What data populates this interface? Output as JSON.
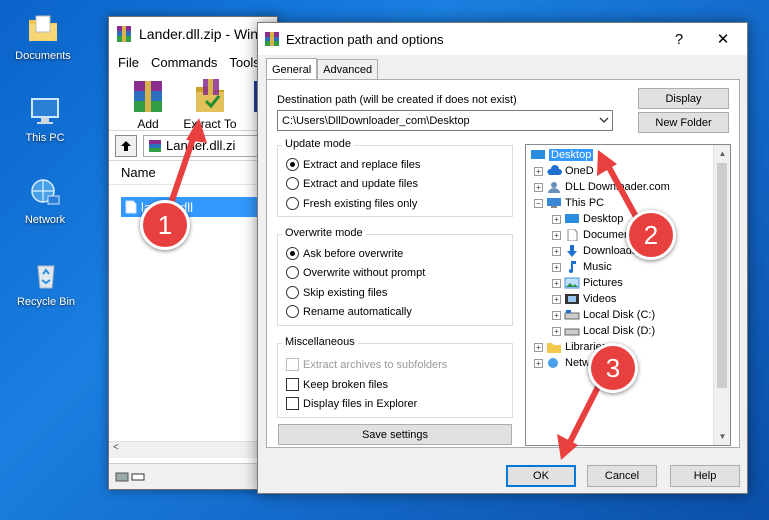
{
  "desktop": {
    "icons": [
      {
        "label": "Documents",
        "icon": "folder-icon"
      },
      {
        "label": "This PC",
        "icon": "computer-icon"
      },
      {
        "label": "Network",
        "icon": "network-icon"
      },
      {
        "label": "Recycle Bin",
        "icon": "recycle-bin-icon"
      }
    ]
  },
  "winrar": {
    "title": "Lander.dll.zip - WinR",
    "menu": [
      "File",
      "Commands",
      "Tools"
    ],
    "toolbar": {
      "add": "Add",
      "extract_to": "Extract To",
      "partial": "T"
    },
    "path": "Lander.dll.zi",
    "column_name": "Name",
    "file": "lander.dll",
    "scroll_left": "<"
  },
  "dialog": {
    "title": "Extraction path and options",
    "help": "?",
    "close": "✕",
    "tabs": [
      "General",
      "Advanced"
    ],
    "dest_label": "Destination path (will be created if does not exist)",
    "dest_value": "C:\\Users\\DllDownloader_com\\Desktop",
    "display_btn": "Display",
    "new_folder_btn": "New Folder",
    "update_mode": {
      "title": "Update mode",
      "options": [
        "Extract and replace files",
        "Extract and update files",
        "Fresh existing files only"
      ],
      "selected": 0
    },
    "overwrite_mode": {
      "title": "Overwrite mode",
      "options": [
        "Ask before overwrite",
        "Overwrite without prompt",
        "Skip existing files",
        "Rename automatically"
      ],
      "selected": 0
    },
    "misc": {
      "title": "Miscellaneous",
      "options": [
        "Extract archives to subfolders",
        "Keep broken files",
        "Display files in Explorer"
      ]
    },
    "save_settings": "Save settings",
    "tree": [
      "Desktop",
      "OneD",
      "DLL Downloader.com",
      "This PC",
      "Desktop",
      "Documen",
      "Downloads",
      "Music",
      "Pictures",
      "Videos",
      "Local Disk (C:)",
      "Local Disk (D:)",
      "Libraries",
      "Netw"
    ],
    "ok": "OK",
    "cancel": "Cancel",
    "help_btn": "Help"
  },
  "markers": [
    "1",
    "2",
    "3"
  ],
  "colors": {
    "accent": "#0078d7",
    "selection": "#3399ff",
    "marker": "#e8403e",
    "desktop": "#1a7fe0"
  }
}
